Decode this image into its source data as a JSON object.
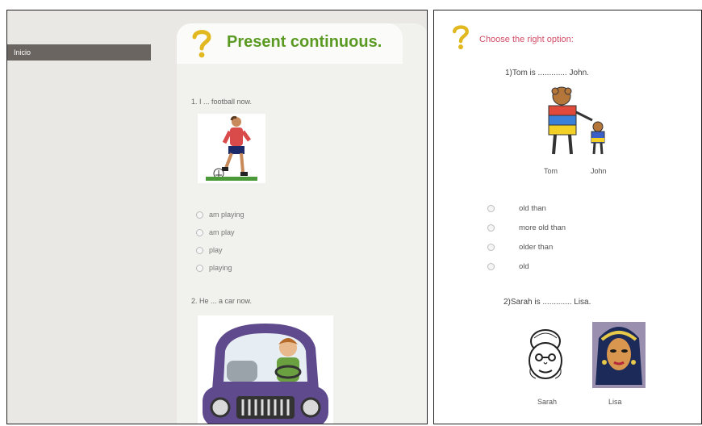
{
  "left_panel": {
    "sidebar": {
      "inicio_label": "Inicio"
    },
    "title": "Present continuous.",
    "q1": {
      "text": "1. I ... football now.",
      "options": [
        "am playing",
        "am play",
        "play",
        "playing"
      ]
    },
    "q2": {
      "text": "2. He ... a car now."
    }
  },
  "right_panel": {
    "heading": "Choose the right option:",
    "q1": {
      "text": "1)Tom is ............. John.",
      "captions": [
        "Tom",
        "John"
      ],
      "options": [
        "old than",
        "more old than",
        "older than",
        "old"
      ]
    },
    "q2": {
      "text": "2)Sarah is ............. Lisa.",
      "captions": [
        "Sarah",
        "Lisa"
      ]
    }
  },
  "colors": {
    "title_green": "#5a9a22",
    "heading_pink": "#d24e68",
    "car_purple": "#5e4a8c"
  }
}
